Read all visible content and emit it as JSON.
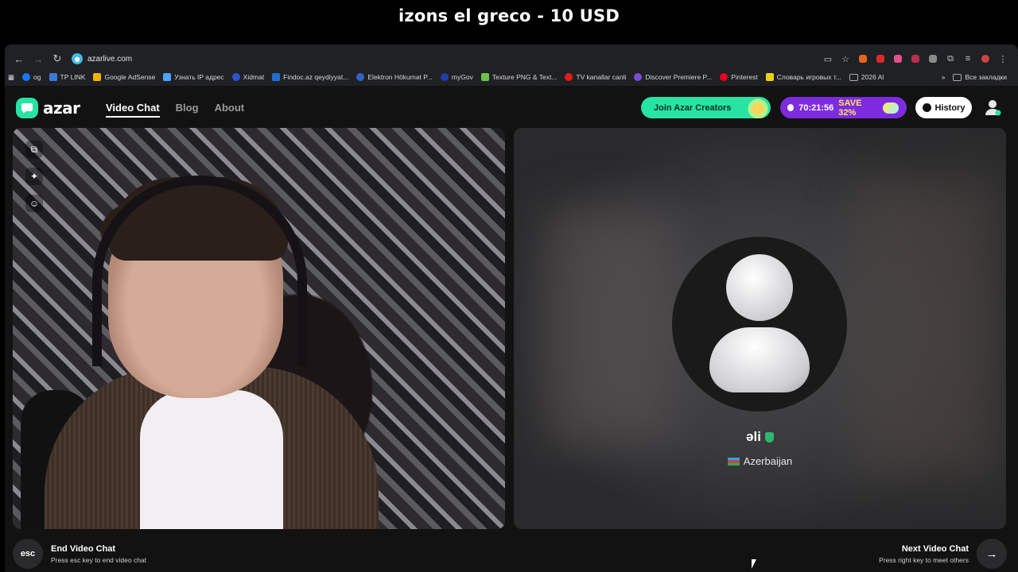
{
  "stream": {
    "title": "izons el greco - 10 USD"
  },
  "browser": {
    "url": "azarlive.com",
    "bookmarks": [
      {
        "label": "og",
        "color": "#1877f2"
      },
      {
        "label": "TP LINK",
        "color": "#3a78d9"
      },
      {
        "label": "Google AdSense",
        "color": "#f4b400"
      },
      {
        "label": "Узнать IP адрес",
        "color": "#4da3ff"
      },
      {
        "label": "Xidmat",
        "color": "#2b55c9"
      },
      {
        "label": "Findoc.az qeydiyyat...",
        "color": "#1f6fd1"
      },
      {
        "label": "Elektron Hökumət P...",
        "color": "#3261c4"
      },
      {
        "label": "myGov",
        "color": "#1f3fa8"
      },
      {
        "label": "Texture PNG & Text...",
        "color": "#6cc24a"
      },
      {
        "label": "TV kanallar canli",
        "color": "#e21c1c"
      },
      {
        "label": "Discover Premiere P...",
        "color": "#7b4cd8"
      },
      {
        "label": "Pinterest",
        "color": "#e60023"
      },
      {
        "label": "Словарь игровых т...",
        "color": "#e8d21b"
      },
      {
        "label": "2026 Al",
        "color": "#888888"
      }
    ],
    "all_bookmarks": "Все закладки"
  },
  "app": {
    "logo": "azar",
    "nav": [
      {
        "label": "Video Chat",
        "active": true
      },
      {
        "label": "Blog",
        "active": false
      },
      {
        "label": "About",
        "active": false
      }
    ],
    "creators_button": "Join Azar Creators",
    "promo": {
      "timer": "70:21:56",
      "save": "SAVE 32%"
    },
    "history_button": "History",
    "colors": {
      "accent_green": "#27e4a4",
      "promo_purple": "#7e2be0"
    }
  },
  "peer": {
    "name": "əli",
    "country": "Azerbaijan"
  },
  "controls": {
    "end": {
      "key": "esc",
      "title": "End Video Chat",
      "subtitle": "Press esc key to end video chat"
    },
    "next": {
      "title": "Next Video Chat",
      "subtitle": "Press right key to meet others"
    }
  }
}
